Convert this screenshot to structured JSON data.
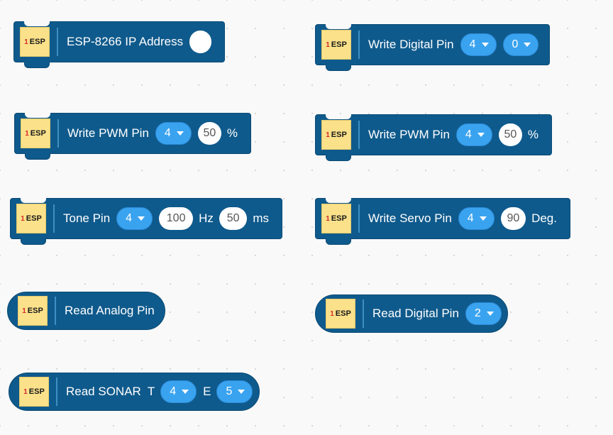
{
  "icon": {
    "number": "1",
    "text": "ESP"
  },
  "blocks": {
    "ip_address": {
      "label": "ESP-8266 IP Address",
      "value": ""
    },
    "write_digital": {
      "label": "Write Digital Pin",
      "pin": "4",
      "value": "0"
    },
    "write_pwm_a": {
      "label": "Write PWM Pin",
      "pin": "4",
      "value": "50",
      "unit": "%"
    },
    "write_pwm_b": {
      "label": "Write PWM Pin",
      "pin": "4",
      "value": "50",
      "unit": "%"
    },
    "tone": {
      "label": "Tone Pin",
      "pin": "4",
      "freq": "100",
      "freq_unit": "Hz",
      "duration": "50",
      "duration_unit": "ms"
    },
    "write_servo": {
      "label": "Write Servo Pin",
      "pin": "4",
      "angle": "90",
      "unit": "Deg."
    },
    "read_analog": {
      "label": "Read Analog Pin"
    },
    "read_digital": {
      "label": "Read Digital Pin",
      "pin": "2"
    },
    "read_sonar": {
      "label": "Read SONAR",
      "trig_label": "T",
      "trig": "4",
      "echo_label": "E",
      "echo": "5"
    }
  }
}
